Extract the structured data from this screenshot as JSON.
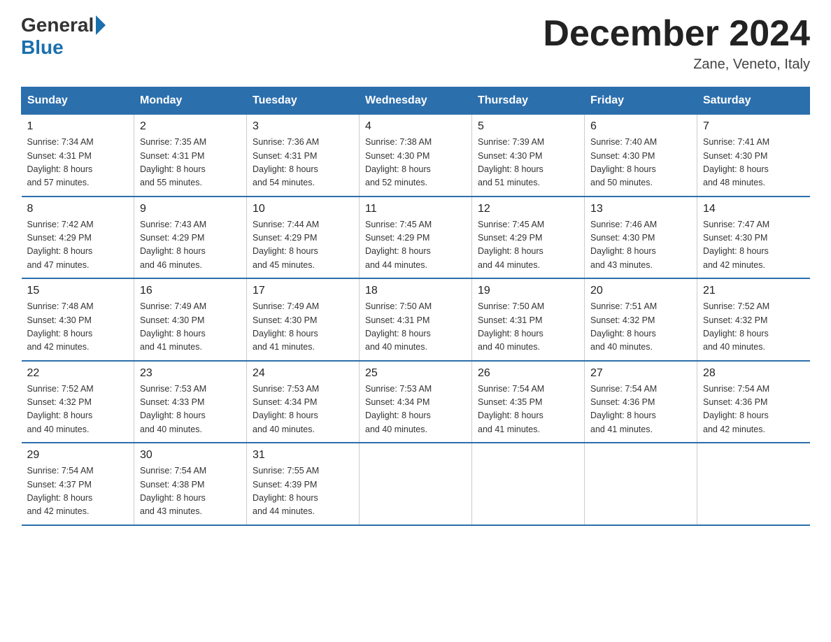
{
  "logo": {
    "general": "General",
    "blue": "Blue"
  },
  "title": "December 2024",
  "location": "Zane, Veneto, Italy",
  "weekdays": [
    "Sunday",
    "Monday",
    "Tuesday",
    "Wednesday",
    "Thursday",
    "Friday",
    "Saturday"
  ],
  "weeks": [
    [
      {
        "day": "1",
        "sunrise": "7:34 AM",
        "sunset": "4:31 PM",
        "daylight": "8 hours and 57 minutes."
      },
      {
        "day": "2",
        "sunrise": "7:35 AM",
        "sunset": "4:31 PM",
        "daylight": "8 hours and 55 minutes."
      },
      {
        "day": "3",
        "sunrise": "7:36 AM",
        "sunset": "4:31 PM",
        "daylight": "8 hours and 54 minutes."
      },
      {
        "day": "4",
        "sunrise": "7:38 AM",
        "sunset": "4:30 PM",
        "daylight": "8 hours and 52 minutes."
      },
      {
        "day": "5",
        "sunrise": "7:39 AM",
        "sunset": "4:30 PM",
        "daylight": "8 hours and 51 minutes."
      },
      {
        "day": "6",
        "sunrise": "7:40 AM",
        "sunset": "4:30 PM",
        "daylight": "8 hours and 50 minutes."
      },
      {
        "day": "7",
        "sunrise": "7:41 AM",
        "sunset": "4:30 PM",
        "daylight": "8 hours and 48 minutes."
      }
    ],
    [
      {
        "day": "8",
        "sunrise": "7:42 AM",
        "sunset": "4:29 PM",
        "daylight": "8 hours and 47 minutes."
      },
      {
        "day": "9",
        "sunrise": "7:43 AM",
        "sunset": "4:29 PM",
        "daylight": "8 hours and 46 minutes."
      },
      {
        "day": "10",
        "sunrise": "7:44 AM",
        "sunset": "4:29 PM",
        "daylight": "8 hours and 45 minutes."
      },
      {
        "day": "11",
        "sunrise": "7:45 AM",
        "sunset": "4:29 PM",
        "daylight": "8 hours and 44 minutes."
      },
      {
        "day": "12",
        "sunrise": "7:45 AM",
        "sunset": "4:29 PM",
        "daylight": "8 hours and 44 minutes."
      },
      {
        "day": "13",
        "sunrise": "7:46 AM",
        "sunset": "4:30 PM",
        "daylight": "8 hours and 43 minutes."
      },
      {
        "day": "14",
        "sunrise": "7:47 AM",
        "sunset": "4:30 PM",
        "daylight": "8 hours and 42 minutes."
      }
    ],
    [
      {
        "day": "15",
        "sunrise": "7:48 AM",
        "sunset": "4:30 PM",
        "daylight": "8 hours and 42 minutes."
      },
      {
        "day": "16",
        "sunrise": "7:49 AM",
        "sunset": "4:30 PM",
        "daylight": "8 hours and 41 minutes."
      },
      {
        "day": "17",
        "sunrise": "7:49 AM",
        "sunset": "4:30 PM",
        "daylight": "8 hours and 41 minutes."
      },
      {
        "day": "18",
        "sunrise": "7:50 AM",
        "sunset": "4:31 PM",
        "daylight": "8 hours and 40 minutes."
      },
      {
        "day": "19",
        "sunrise": "7:50 AM",
        "sunset": "4:31 PM",
        "daylight": "8 hours and 40 minutes."
      },
      {
        "day": "20",
        "sunrise": "7:51 AM",
        "sunset": "4:32 PM",
        "daylight": "8 hours and 40 minutes."
      },
      {
        "day": "21",
        "sunrise": "7:52 AM",
        "sunset": "4:32 PM",
        "daylight": "8 hours and 40 minutes."
      }
    ],
    [
      {
        "day": "22",
        "sunrise": "7:52 AM",
        "sunset": "4:32 PM",
        "daylight": "8 hours and 40 minutes."
      },
      {
        "day": "23",
        "sunrise": "7:53 AM",
        "sunset": "4:33 PM",
        "daylight": "8 hours and 40 minutes."
      },
      {
        "day": "24",
        "sunrise": "7:53 AM",
        "sunset": "4:34 PM",
        "daylight": "8 hours and 40 minutes."
      },
      {
        "day": "25",
        "sunrise": "7:53 AM",
        "sunset": "4:34 PM",
        "daylight": "8 hours and 40 minutes."
      },
      {
        "day": "26",
        "sunrise": "7:54 AM",
        "sunset": "4:35 PM",
        "daylight": "8 hours and 41 minutes."
      },
      {
        "day": "27",
        "sunrise": "7:54 AM",
        "sunset": "4:36 PM",
        "daylight": "8 hours and 41 minutes."
      },
      {
        "day": "28",
        "sunrise": "7:54 AM",
        "sunset": "4:36 PM",
        "daylight": "8 hours and 42 minutes."
      }
    ],
    [
      {
        "day": "29",
        "sunrise": "7:54 AM",
        "sunset": "4:37 PM",
        "daylight": "8 hours and 42 minutes."
      },
      {
        "day": "30",
        "sunrise": "7:54 AM",
        "sunset": "4:38 PM",
        "daylight": "8 hours and 43 minutes."
      },
      {
        "day": "31",
        "sunrise": "7:55 AM",
        "sunset": "4:39 PM",
        "daylight": "8 hours and 44 minutes."
      },
      null,
      null,
      null,
      null
    ]
  ],
  "labels": {
    "sunrise": "Sunrise:",
    "sunset": "Sunset:",
    "daylight": "Daylight:"
  }
}
